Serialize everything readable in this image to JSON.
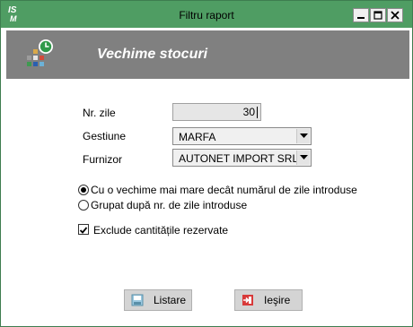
{
  "window": {
    "title": "Filtru raport",
    "app_logo": "I S M",
    "controls": [
      "minimize-icon",
      "maximize-icon",
      "close-icon"
    ]
  },
  "header": {
    "title": "Vechime stocuri",
    "icon": "stock-clock-icon"
  },
  "form": {
    "days_label": "Nr. zile",
    "days_value": "30",
    "gestiune_label": "Gestiune",
    "gestiune_value": "MARFA",
    "furnizor_label": "Furnizor",
    "furnizor_value": "AUTONET IMPORT SRL"
  },
  "options": {
    "radio_older": "Cu o vechime mai mare decât numărul de zile introduse",
    "radio_grouped": "Grupat după nr. de zile introduse",
    "selected": "radio_older",
    "exclude_reserved_label": "Exclude cantitățile rezervate",
    "exclude_reserved_checked": true
  },
  "buttons": {
    "list_label": "Listare",
    "exit_label": "Ieşire"
  },
  "colors": {
    "titlebar": "#4f9d63",
    "header_band": "#808080",
    "button_face": "#d4d4d4"
  }
}
